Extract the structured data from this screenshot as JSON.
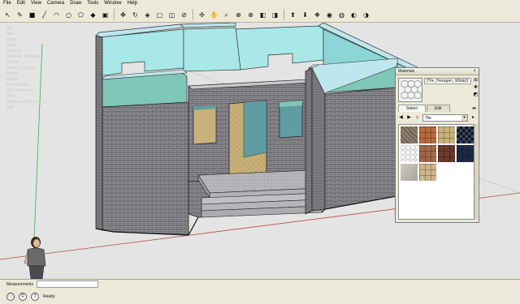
{
  "menu": [
    "File",
    "Edit",
    "View",
    "Camera",
    "Draw",
    "Tools",
    "Window",
    "Help"
  ],
  "toolbar_icons": [
    {
      "name": "select-icon",
      "glyph": "↖"
    },
    {
      "name": "eraser-icon",
      "glyph": "✎"
    },
    {
      "name": "rectangle-icon",
      "glyph": "■"
    },
    {
      "name": "line-icon",
      "glyph": "╱"
    },
    {
      "name": "arc-icon",
      "glyph": "◠"
    },
    {
      "name": "circle-icon",
      "glyph": "○"
    },
    {
      "name": "polygon-icon",
      "glyph": "⬠"
    },
    {
      "name": "paint-bucket-icon",
      "glyph": "◆"
    },
    {
      "name": "push-pull-icon",
      "glyph": "▣"
    },
    {
      "name": "move-icon",
      "glyph": "✥"
    },
    {
      "name": "rotate-icon",
      "glyph": "↻"
    },
    {
      "name": "follow-me-icon",
      "glyph": "◈"
    },
    {
      "name": "scale-icon",
      "glyph": "▢"
    },
    {
      "name": "offset-icon",
      "glyph": "◫"
    },
    {
      "name": "tape-measure-icon",
      "glyph": "⊘"
    },
    {
      "name": "orbit-icon",
      "glyph": "✣"
    },
    {
      "name": "pan-icon",
      "glyph": "✋"
    },
    {
      "name": "zoom-icon",
      "glyph": "⌕"
    },
    {
      "name": "zoom-window-icon",
      "glyph": "⊕"
    },
    {
      "name": "zoom-extents-icon",
      "glyph": "⊗"
    },
    {
      "name": "previous-view-icon",
      "glyph": "◧"
    },
    {
      "name": "next-view-icon",
      "glyph": "◨"
    },
    {
      "name": "get-models-icon",
      "glyph": "⬆"
    },
    {
      "name": "share-model-icon",
      "glyph": "⬇"
    },
    {
      "name": "components-icon",
      "glyph": "❖"
    },
    {
      "name": "materials-icon",
      "glyph": "◉"
    },
    {
      "name": "styles-icon",
      "glyph": "◍"
    },
    {
      "name": "google-earth-icon",
      "glyph": "◐"
    },
    {
      "name": "extension-icon",
      "glyph": "◑"
    }
  ],
  "ghost_menu": [
    "File",
    "New",
    "Open",
    "Save",
    "Save As...",
    "Save As Template...",
    "Revert",
    "Send to LayOut",
    "Import...",
    "Export",
    "Print Setup...",
    "Print Preview...",
    "Print...",
    "Generate Report",
    "Exit"
  ],
  "materials_panel": {
    "title": "Materials",
    "material_name": "[Tile_Hexagon_White]1",
    "tabs": [
      "Select",
      "Edit"
    ],
    "library": "Tile",
    "swatches": [
      {
        "name": "swatch-tile-diamond-gray",
        "color": "#8c7d6b",
        "pattern": "diamond"
      },
      {
        "name": "swatch-tile-terracotta",
        "color": "#b8683a",
        "pattern": "grid"
      },
      {
        "name": "swatch-tile-beige",
        "color": "#c9b27a",
        "pattern": "grid"
      },
      {
        "name": "swatch-tile-checker-black",
        "color": "#222222",
        "pattern": "checker"
      },
      {
        "name": "swatch-tile-hexagon-white",
        "color": "#e8e8e8",
        "pattern": "hex"
      },
      {
        "name": "swatch-tile-brown",
        "color": "#a06848",
        "pattern": "grid"
      },
      {
        "name": "swatch-tile-dark-red",
        "color": "#6a3a2a",
        "pattern": "grid"
      },
      {
        "name": "swatch-tile-navy",
        "color": "#1e2a44",
        "pattern": "grid"
      },
      {
        "name": "swatch-tile-stone-gray",
        "color": "#bdbab0",
        "pattern": "stone"
      },
      {
        "name": "swatch-tile-sandstone",
        "color": "#cdb48a",
        "pattern": "grid"
      }
    ]
  },
  "status": {
    "measurements_label": "Measurements",
    "measurements_value": "",
    "status_text": "Ready"
  },
  "colors": {
    "brick": "#8e8e93",
    "wall_top": "#a8e8e8",
    "interior_wall": "#5f9ea0",
    "teal_wall": "#7fc7b8",
    "floor": "#c8b27a",
    "background": "#e4e4e4"
  }
}
